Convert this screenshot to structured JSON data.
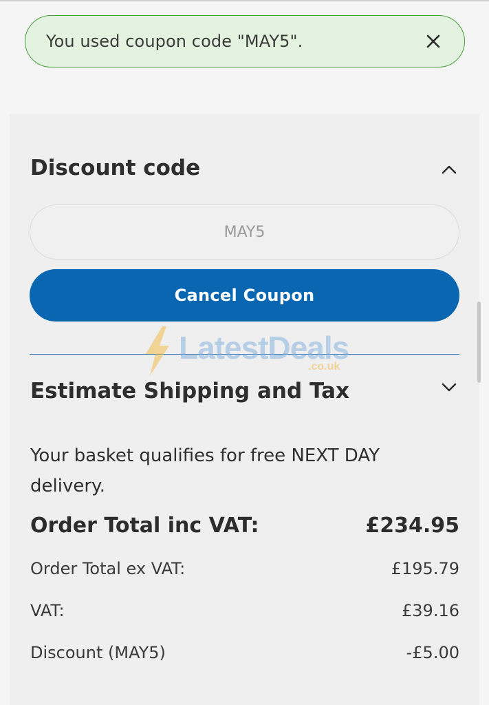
{
  "notice": {
    "message": "You used coupon code \"MAY5\".",
    "close_icon": "close-icon"
  },
  "discount": {
    "title": "Discount code",
    "toggle_icon": "chevron-up-icon",
    "code_value": "MAY5",
    "cancel_label": "Cancel Coupon"
  },
  "watermark": {
    "text": "LatestDeals",
    "sub": ".co.uk"
  },
  "shipping": {
    "title": "Estimate Shipping and Tax",
    "toggle_icon": "chevron-down-icon",
    "message": "Your basket qualifies for free NEXT DAY delivery."
  },
  "totals": {
    "order_total_inc_label": "Order Total inc VAT:",
    "order_total_inc_value": "£234.95",
    "order_total_ex_label": "Order Total ex VAT:",
    "order_total_ex_value": "£195.79",
    "vat_label": "VAT:",
    "vat_value": "£39.16",
    "discount_label": "Discount (MAY5)",
    "discount_value": "-£5.00"
  },
  "colors": {
    "notice_bg": "#e3f3df",
    "notice_border": "#4a9a3a",
    "primary_button": "#0a66b0",
    "divider": "#1e63a6"
  }
}
